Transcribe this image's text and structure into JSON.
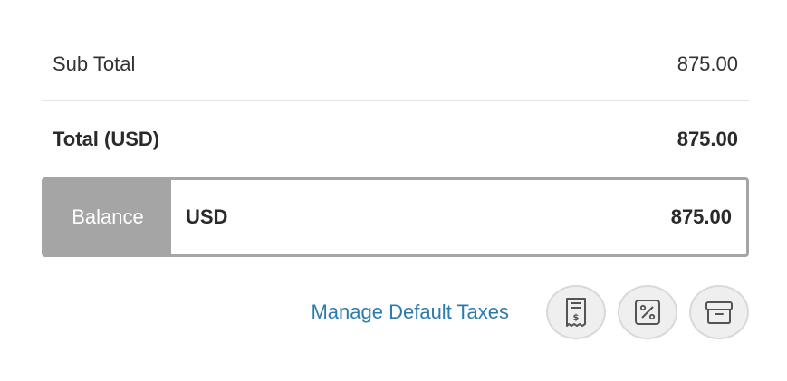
{
  "summary": {
    "sub_total_label": "Sub Total",
    "sub_total_value": "875.00",
    "total_label": "Total (USD)",
    "total_value": "875.00"
  },
  "balance": {
    "label": "Balance",
    "currency": "USD",
    "amount": "875.00"
  },
  "actions": {
    "manage_taxes_link": "Manage Default Taxes",
    "icons": [
      "receipt-icon",
      "percent-icon",
      "archive-box-icon"
    ]
  }
}
